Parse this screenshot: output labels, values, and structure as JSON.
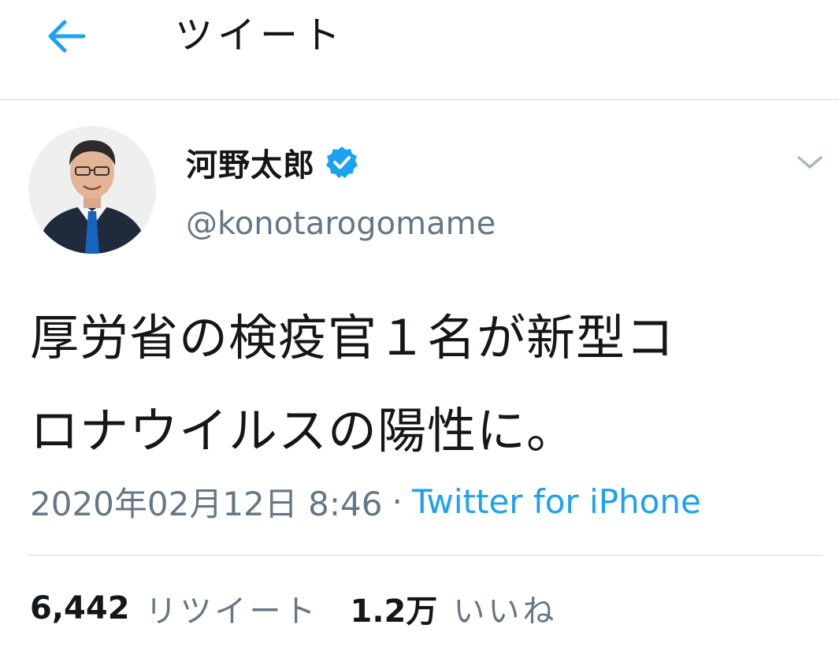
{
  "header": {
    "back_icon": "arrow-left-icon",
    "title": "ツイート"
  },
  "tweet": {
    "author": {
      "name": "河野太郎",
      "handle": "@konotarogomame",
      "verified": true
    },
    "text_lines": [
      "厚労省の検疫官１名が新型コ",
      "ロナウイルスの陽性に。"
    ],
    "meta": {
      "timestamp": "2020年02月12日 8:46",
      "separator": "·",
      "source": "Twitter for iPhone"
    },
    "stats": {
      "retweets": {
        "count": "6,442",
        "label": "リツイート"
      },
      "likes": {
        "count": "1.2万",
        "label": "いいね"
      }
    }
  },
  "colors": {
    "accent": "#1da1f2",
    "text_primary": "#14171a",
    "text_secondary": "#657786",
    "divider": "#d5d9dc"
  }
}
